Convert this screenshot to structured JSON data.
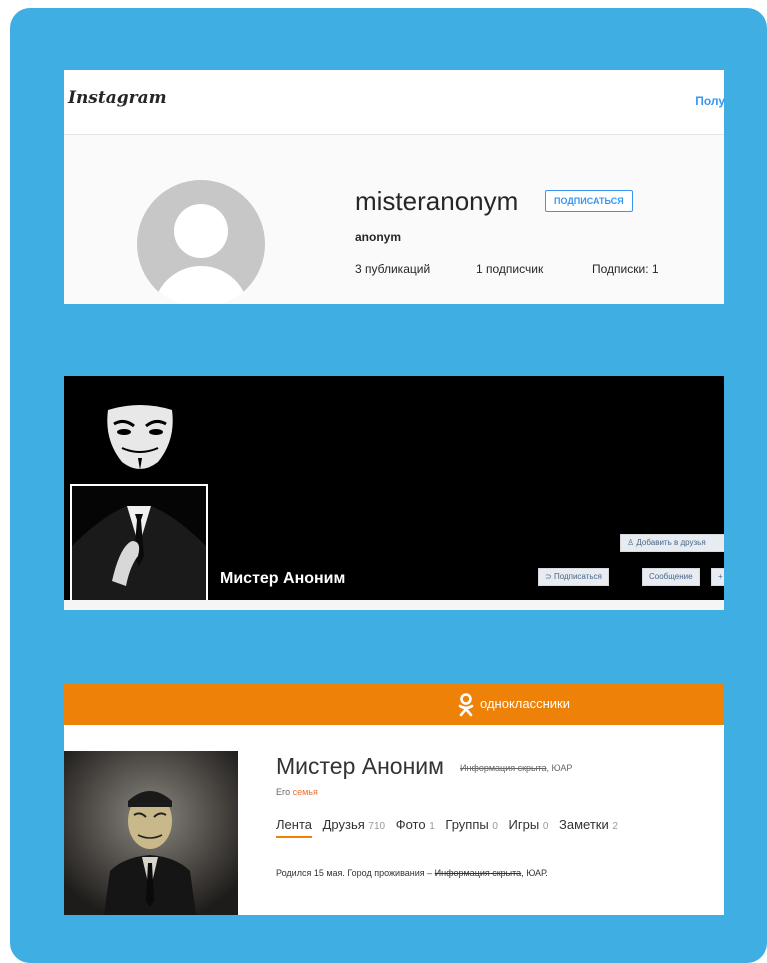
{
  "instagram": {
    "logo": "Instagram",
    "login_link": "Получ",
    "username": "misteranonym",
    "follow_button": "ПОДПИСАТЬСЯ",
    "full_name": "anonym",
    "stats": {
      "posts": "3 публикаций",
      "followers": "1 подписчик",
      "following": "Подписки: 1"
    }
  },
  "vk": {
    "profile_name": "Мистер Аноним",
    "add_friend_button": "Добавить в друзья",
    "subscribe_button": "Подписаться",
    "message_button": "Сообщение",
    "more_button": "+"
  },
  "odnoklassniki": {
    "brand": "одноклассники",
    "profile_name": "Мистер Аноним",
    "location_hidden": "Информация скрыта",
    "location_country": ", ЮАР",
    "family_prefix": "Его ",
    "family_link": "семья",
    "tabs": [
      {
        "label": "Лента",
        "count": ""
      },
      {
        "label": "Друзья",
        "count": "710"
      },
      {
        "label": "Фото",
        "count": "1"
      },
      {
        "label": "Группы",
        "count": "0"
      },
      {
        "label": "Игры",
        "count": "0"
      },
      {
        "label": "Заметки",
        "count": "2"
      }
    ],
    "about_prefix": "Родился 15 мая. Город проживания – ",
    "about_hidden": "Информация скрыта",
    "about_suffix": ", ЮАР."
  },
  "colors": {
    "background": "#3eaee3",
    "ok_orange": "#ee8208",
    "instagram_blue": "#3897f0"
  }
}
